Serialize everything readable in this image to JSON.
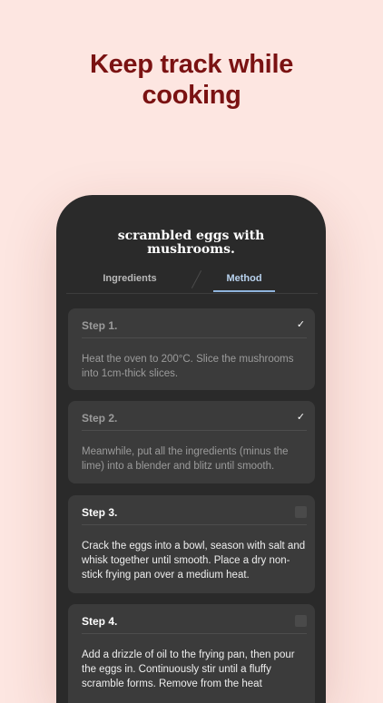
{
  "headline": {
    "line1": "Keep track while",
    "line2": "cooking"
  },
  "recipe": {
    "title_line1": "scrambled eggs with",
    "title_line2": "mushrooms."
  },
  "tabs": {
    "ingredients": "Ingredients",
    "method": "Method",
    "active": "Method"
  },
  "steps": [
    {
      "label": "Step 1.",
      "checked": true,
      "check_glyph": "✓",
      "text": "Heat the oven to 200°C. Slice the mushrooms into 1cm-thick slices."
    },
    {
      "label": "Step 2.",
      "checked": true,
      "check_glyph": "✓",
      "text": "Meanwhile, put all the ingredients (minus the lime) into a blender and blitz until smooth."
    },
    {
      "label": "Step 3.",
      "checked": false,
      "check_glyph": "",
      "text": "Crack the eggs into a bowl, season with salt and whisk together until smooth. Place a dry non-stick frying pan over a medium heat."
    },
    {
      "label": "Step 4.",
      "checked": false,
      "check_glyph": "",
      "text": "Add a drizzle of oil to the frying pan, then pour the eggs in. Continuously stir until a fluffy scramble forms. Remove from the heat"
    }
  ],
  "colors": {
    "background": "#fde6e1",
    "headline": "#7a1212",
    "phone": "#2a2a2a",
    "card": "#3b3b3b",
    "active_tab": "#8fb4dc"
  }
}
